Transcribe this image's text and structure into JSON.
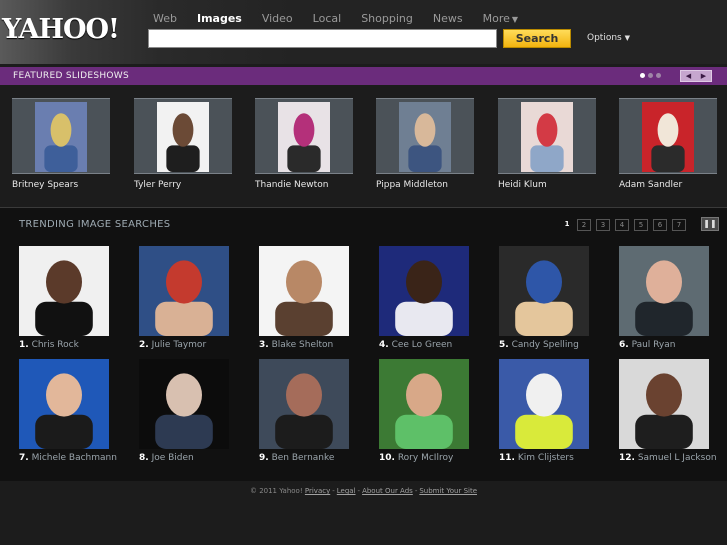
{
  "header": {
    "logo_text": "YAHOO!",
    "nav": [
      {
        "label": "Web",
        "active": false
      },
      {
        "label": "Images",
        "active": true
      },
      {
        "label": "Video",
        "active": false
      },
      {
        "label": "Local",
        "active": false
      },
      {
        "label": "Shopping",
        "active": false
      },
      {
        "label": "News",
        "active": false
      },
      {
        "label": "More",
        "active": false,
        "caret": true
      }
    ],
    "search_value": "",
    "search_button": "Search",
    "options_label": "Options"
  },
  "featured": {
    "title": "FEATURED SLIDESHOWS",
    "pages": 3,
    "current_page": 1,
    "items": [
      {
        "name": "Britney Spears",
        "colors": [
          "#6a7eb0",
          "#d8c06a",
          "#3e5f9a"
        ]
      },
      {
        "name": "Tyler Perry",
        "colors": [
          "#f2f2f2",
          "#6b4a36",
          "#1e1e1e"
        ]
      },
      {
        "name": "Thandie Newton",
        "colors": [
          "#e8e2e6",
          "#b4307a",
          "#2a2a2a"
        ]
      },
      {
        "name": "Pippa Middleton",
        "colors": [
          "#6f7f93",
          "#d8b89a",
          "#3d5580"
        ]
      },
      {
        "name": "Heidi Klum",
        "colors": [
          "#e9d9d6",
          "#d33a45",
          "#8fa7c8"
        ]
      },
      {
        "name": "Adam Sandler",
        "colors": [
          "#c9242a",
          "#f1e6d8",
          "#2b2b2b"
        ]
      }
    ]
  },
  "trending": {
    "title": "TRENDING IMAGE SEARCHES",
    "pages": [
      "1",
      "2",
      "3",
      "4",
      "5",
      "6",
      "7"
    ],
    "current_page": "1",
    "pause_label": "❚❚",
    "items": [
      {
        "num": "1.",
        "name": "Chris Rock",
        "colors": [
          "#f0f0f0",
          "#5b3a2a",
          "#111111"
        ]
      },
      {
        "num": "2.",
        "name": "Julie Taymor",
        "colors": [
          "#2f4f86",
          "#c43a2e",
          "#d9b195"
        ]
      },
      {
        "num": "3.",
        "name": "Blake Shelton",
        "colors": [
          "#f4f4f4",
          "#b88866",
          "#5a4030"
        ]
      },
      {
        "num": "4.",
        "name": "Cee Lo Green",
        "colors": [
          "#1e2a7a",
          "#3a2418",
          "#e8e8f0"
        ]
      },
      {
        "num": "5.",
        "name": "Candy Spelling",
        "colors": [
          "#2a2a2a",
          "#2e56a8",
          "#e4c69c"
        ]
      },
      {
        "num": "6.",
        "name": "Paul Ryan",
        "colors": [
          "#5e6b72",
          "#dfb09a",
          "#20262c"
        ]
      },
      {
        "num": "7.",
        "name": "Michele Bachmann",
        "colors": [
          "#1f58b8",
          "#e2b79a",
          "#1b1b1b"
        ]
      },
      {
        "num": "8.",
        "name": "Joe Biden",
        "colors": [
          "#0c0c0c",
          "#d8c0b0",
          "#2d3a52"
        ]
      },
      {
        "num": "9.",
        "name": "Ben Bernanke",
        "colors": [
          "#3e4a5a",
          "#a56c5a",
          "#1c1c1c"
        ]
      },
      {
        "num": "10.",
        "name": "Rory McIlroy",
        "colors": [
          "#3c7a34",
          "#d8a888",
          "#5ec068"
        ]
      },
      {
        "num": "11.",
        "name": "Kim Clijsters",
        "colors": [
          "#3a5aa8",
          "#f0f0f0",
          "#d9ea3a"
        ]
      },
      {
        "num": "12.",
        "name": "Samuel L Jackson",
        "colors": [
          "#d9d9d9",
          "#6a4230",
          "#1e1e1e"
        ]
      }
    ]
  },
  "footer": {
    "copyright": "© 2011 Yahoo!",
    "links": [
      "Privacy",
      "Legal",
      "About Our Ads",
      "Submit Your Site"
    ]
  }
}
